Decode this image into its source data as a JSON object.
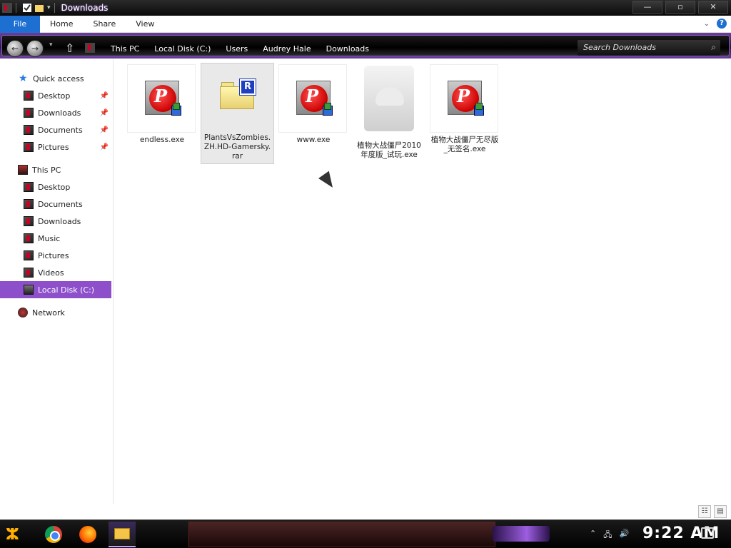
{
  "window": {
    "title": "Downloads",
    "min": "—",
    "max": "▫",
    "close": "✕"
  },
  "ribbon": {
    "tabs": [
      "File",
      "Home",
      "Share",
      "View"
    ],
    "help": "?"
  },
  "address": {
    "crumbs": [
      "This PC",
      "Local Disk (C:)",
      "Users",
      "Audrey Hale",
      "Downloads"
    ],
    "search_placeholder": "Search Downloads"
  },
  "nav": {
    "quick_access": "Quick access",
    "quick_items": [
      "Desktop",
      "Downloads",
      "Documents",
      "Pictures"
    ],
    "this_pc": "This PC",
    "pc_items": [
      "Desktop",
      "Documents",
      "Downloads",
      "Music",
      "Pictures",
      "Videos",
      "Local Disk (C:)"
    ],
    "network": "Network"
  },
  "files": [
    {
      "name": "endless.exe",
      "type": "exe"
    },
    {
      "name": "PlantsVsZombies.ZH.HD-Gamersky.rar",
      "type": "rar",
      "selected": true
    },
    {
      "name": "www.exe",
      "type": "exe"
    },
    {
      "name": "植物大战僵尸2010年度版_试玩.exe",
      "type": "generic"
    },
    {
      "name": "植物大战僵尸无尽版_无签名.exe",
      "type": "exe"
    }
  ],
  "taskbar": {
    "clock": "9:22 AM"
  },
  "colors": {
    "accent": "#8e4fcb",
    "file_tab": "#1e6fd2"
  }
}
